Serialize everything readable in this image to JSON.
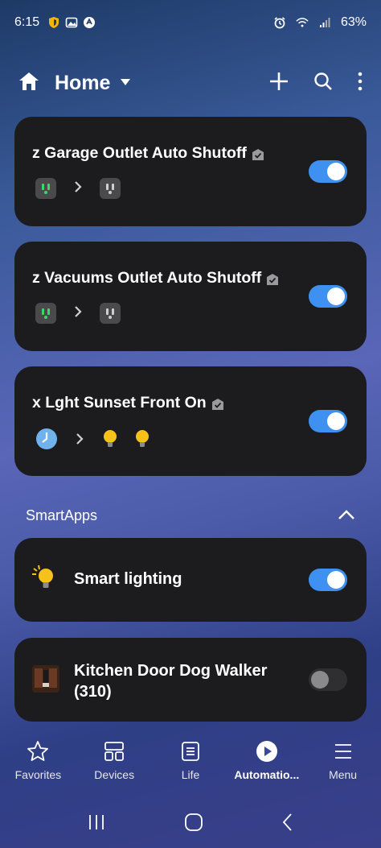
{
  "status_bar": {
    "time": "6:15",
    "battery": "63%",
    "left_icons": [
      "shield-badge-icon",
      "gallery-icon",
      "sync-icon"
    ],
    "right_icons": [
      "alarm-icon",
      "wifi-icon",
      "signal-icon"
    ]
  },
  "header": {
    "title": "Home"
  },
  "scenes": [
    {
      "title": "z Garage Outlet Auto Shutoff",
      "enabled": true
    },
    {
      "title": "z Vacuums Outlet Auto Shutoff",
      "enabled": true
    },
    {
      "title": "x Lght Sunset Front On",
      "enabled": true
    }
  ],
  "smartapps": {
    "heading": "SmartApps",
    "items": [
      {
        "label": "Smart lighting",
        "enabled": true
      },
      {
        "label": "Kitchen Door Dog Walker (310)",
        "enabled": false
      }
    ]
  },
  "bottom_nav": {
    "items": [
      {
        "label": "Favorites",
        "icon": "star-icon"
      },
      {
        "label": "Devices",
        "icon": "devices-icon"
      },
      {
        "label": "Life",
        "icon": "life-icon"
      },
      {
        "label": "Automatio...",
        "icon": "play-icon",
        "active": true
      },
      {
        "label": "Menu",
        "icon": "menu-icon"
      }
    ]
  },
  "colors": {
    "toggle_on": "#3e91f0",
    "card_bg": "#1c1c1e",
    "outlet_on_indicator": "#3dd66b",
    "bulb_yellow": "#f6c21a"
  }
}
